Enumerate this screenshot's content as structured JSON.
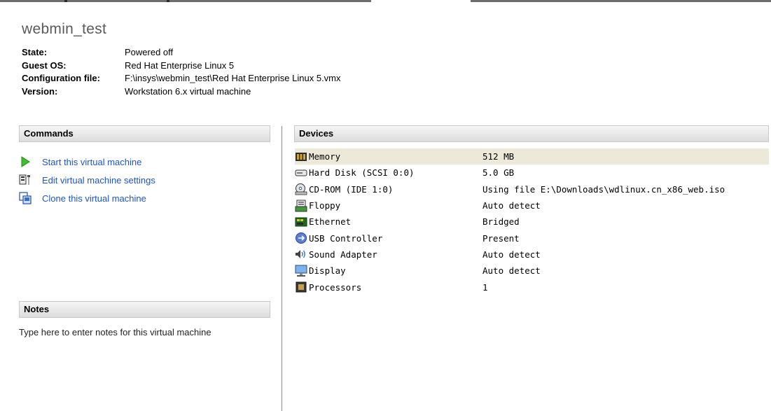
{
  "vm": {
    "name": "webmin_test",
    "properties": [
      {
        "label": "State:",
        "value": "Powered off"
      },
      {
        "label": "Guest OS:",
        "value": "Red Hat Enterprise Linux 5"
      },
      {
        "label": "Configuration file:",
        "value": "F:\\insys\\webmin_test\\Red Hat Enterprise Linux 5.vmx"
      },
      {
        "label": "Version:",
        "value": "Workstation 6.x virtual machine"
      }
    ]
  },
  "commands": {
    "title": "Commands",
    "items": [
      {
        "label": "Start this virtual machine",
        "icon": "play-icon"
      },
      {
        "label": "Edit virtual machine settings",
        "icon": "settings-icon"
      },
      {
        "label": "Clone this virtual machine",
        "icon": "clone-icon"
      }
    ]
  },
  "notes": {
    "title": "Notes",
    "placeholder": "Type here to enter notes for this virtual machine"
  },
  "devices": {
    "title": "Devices",
    "items": [
      {
        "name": "Memory",
        "value": "512 MB",
        "icon": "memory-icon",
        "selected": true
      },
      {
        "name": "Hard Disk (SCSI 0:0)",
        "value": "5.0 GB",
        "icon": "hard-disk-icon"
      },
      {
        "name": "CD-ROM (IDE 1:0)",
        "value": "Using file E:\\Downloads\\wdlinux.cn_x86_web.iso",
        "icon": "cdrom-icon"
      },
      {
        "name": "Floppy",
        "value": "Auto detect",
        "icon": "floppy-icon"
      },
      {
        "name": "Ethernet",
        "value": "Bridged",
        "icon": "ethernet-icon"
      },
      {
        "name": "USB Controller",
        "value": "Present",
        "icon": "usb-icon"
      },
      {
        "name": "Sound Adapter",
        "value": "Auto detect",
        "icon": "sound-icon"
      },
      {
        "name": "Display",
        "value": "Auto detect",
        "icon": "display-icon"
      },
      {
        "name": "Processors",
        "value": "1",
        "icon": "processor-icon"
      }
    ]
  },
  "colors": {
    "link": "#1b56c8",
    "selected_row": "#ece9d8",
    "header_bg": "#dcdcdc"
  }
}
